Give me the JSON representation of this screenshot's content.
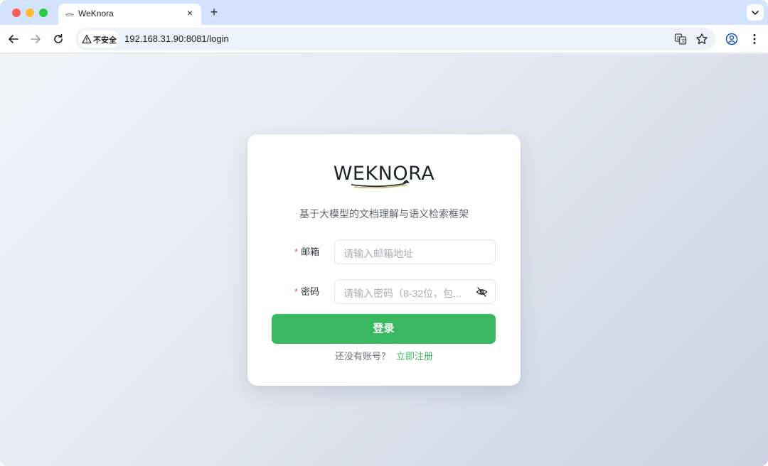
{
  "browser": {
    "tab_title": "WeKnora",
    "tab_close": "×",
    "new_tab": "+",
    "security_label": "不安全",
    "url": "192.168.31.90:8081/login"
  },
  "login": {
    "logo_text": "WEKNORA",
    "subtitle": "基于大模型的文档理解与语义检索框架",
    "required_mark": "*",
    "email_label": "邮箱",
    "email_placeholder": "请输入邮箱地址",
    "password_label": "密码",
    "password_placeholder": "请输入密码（8-32位，包...",
    "submit_label": "登录",
    "no_account_text": "还没有账号？",
    "register_link": "立即注册"
  },
  "colors": {
    "accent": "#3ab861",
    "required": "#e34d59",
    "tabstrip": "#d3e3fd"
  },
  "icons": {
    "traffic_lights": [
      "close",
      "minimize",
      "zoom"
    ],
    "toolbar": [
      "back-arrow-icon",
      "forward-arrow-icon",
      "reload-icon",
      "warning-icon",
      "translate-icon",
      "star-icon",
      "profile-icon",
      "more-vert-icon"
    ],
    "password_toggle": "eye-off-icon"
  }
}
